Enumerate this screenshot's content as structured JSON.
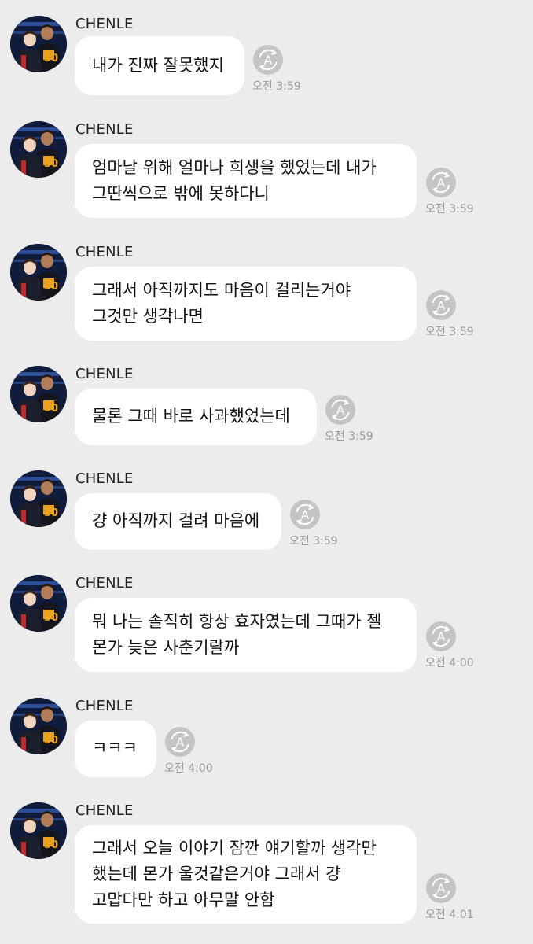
{
  "sender_name": "CHENLE",
  "messages": [
    {
      "lines": [
        "내가 진짜 잘못했지"
      ],
      "time": "오전 3:59"
    },
    {
      "lines": [
        "엄마날 위해 얼마나 희생을 했었는데 내가",
        "그딴씩으로 밖에 못하다니"
      ],
      "time": "오전 3:59"
    },
    {
      "lines": [
        "그래서 아직까지도 마음이 걸리는거야",
        "그것만 생각나면"
      ],
      "time": "오전 3:59"
    },
    {
      "lines": [
        "물론 그때 바로 사과했었는데"
      ],
      "time": "오전 3:59"
    },
    {
      "lines": [
        "걍 아직까지 걸려 마음에"
      ],
      "time": "오전 3:59"
    },
    {
      "lines": [
        "뭐 나는 솔직히 항상 효자였는데 그때가 젤",
        "몬가 늦은 사춘기랄까"
      ],
      "time": "오전 4:00"
    },
    {
      "lines": [
        "ㅋㅋㅋ"
      ],
      "time": "오전 4:00"
    },
    {
      "lines": [
        "그래서 오늘 이야기 잠깐 얘기할까 생각만",
        "했는데 몬가 울것같은거야 그래서 걍",
        "고맙다만 하고 아무말 안함"
      ],
      "time": "오전 4:01"
    }
  ],
  "icons": {
    "avatar": "profile-photo",
    "translate": "translate-icon"
  },
  "colors": {
    "background": "#ececec",
    "bubble": "#ffffff",
    "time": "#9a9a9a",
    "icon": "#c4c4c4"
  }
}
